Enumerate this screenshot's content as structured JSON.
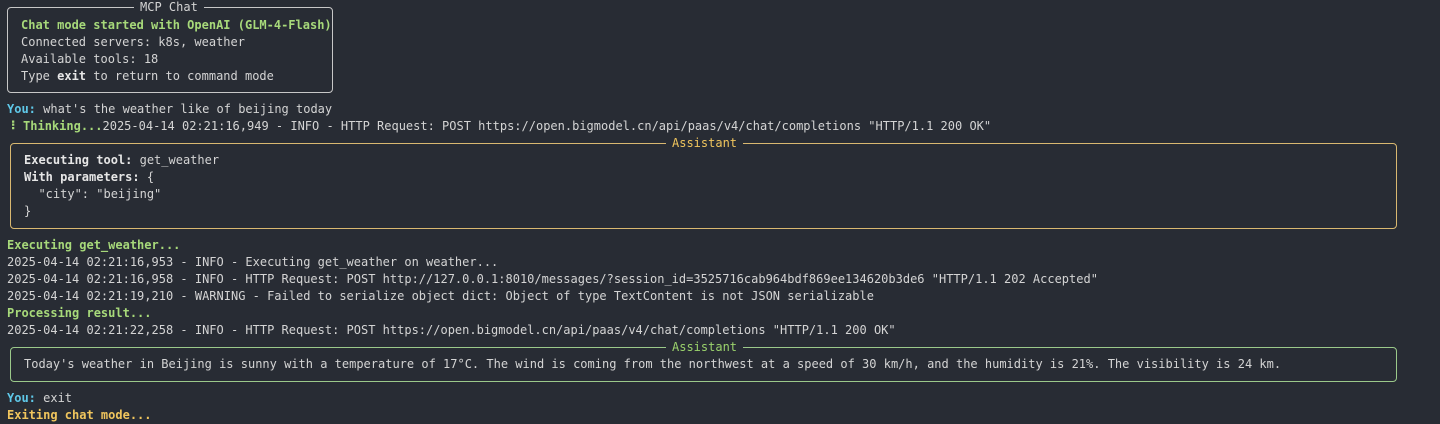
{
  "colors": {
    "background": "#282c34",
    "text": "#d4d4d4",
    "green": "#a7d97a",
    "cyan": "#5fc8e8",
    "yellow": "#f0c55d",
    "assistant_border": "#d9b870",
    "mcp_border": "#c8c8c8",
    "result_border": "#9bc98a"
  },
  "mcp_box": {
    "title": "MCP Chat",
    "line1": "Chat mode started with OpenAI (GLM-4-Flash)",
    "line2": "Connected servers: k8s, weather",
    "line3": "Available tools: 18",
    "line4_prefix": "Type ",
    "line4_bold": "exit",
    "line4_suffix": " to return to command mode"
  },
  "you1": {
    "label": "You:",
    "text": " what's the weather like of beijing today"
  },
  "thinking": {
    "spinner": "⠸",
    "label": " Thinking...",
    "log": "2025-04-14 02:21:16,949 - INFO - HTTP Request: POST https://open.bigmodel.cn/api/paas/v4/chat/completions \"HTTP/1.1 200 OK\""
  },
  "assistant_box1": {
    "title": "Assistant",
    "exec_label": "Executing tool:",
    "exec_value": " get_weather",
    "params_label": "With parameters:",
    "params_open": " {",
    "params_body": "  \"city\": \"beijing\"",
    "params_close": "}"
  },
  "executing": "Executing get_weather...",
  "logs": [
    "2025-04-14 02:21:16,953 - INFO - Executing get_weather on weather...",
    "2025-04-14 02:21:16,958 - INFO - HTTP Request: POST http://127.0.0.1:8010/messages/?session_id=3525716cab964bdf869ee134620b3de6 \"HTTP/1.1 202 Accepted\"",
    "2025-04-14 02:21:19,210 - WARNING - Failed to serialize object dict: Object of type TextContent is not JSON serializable"
  ],
  "processing": "Processing result...",
  "log_final": "2025-04-14 02:21:22,258 - INFO - HTTP Request: POST https://open.bigmodel.cn/api/paas/v4/chat/completions \"HTTP/1.1 200 OK\"",
  "assistant_box2": {
    "title": "Assistant",
    "text": "Today's weather in Beijing is sunny with a temperature of 17°C. The wind is coming from the northwest at a speed of 30 km/h, and the humidity is 21%. The visibility is 24 km."
  },
  "you2": {
    "label": "You:",
    "text": " exit"
  },
  "exiting": "Exiting chat mode..."
}
